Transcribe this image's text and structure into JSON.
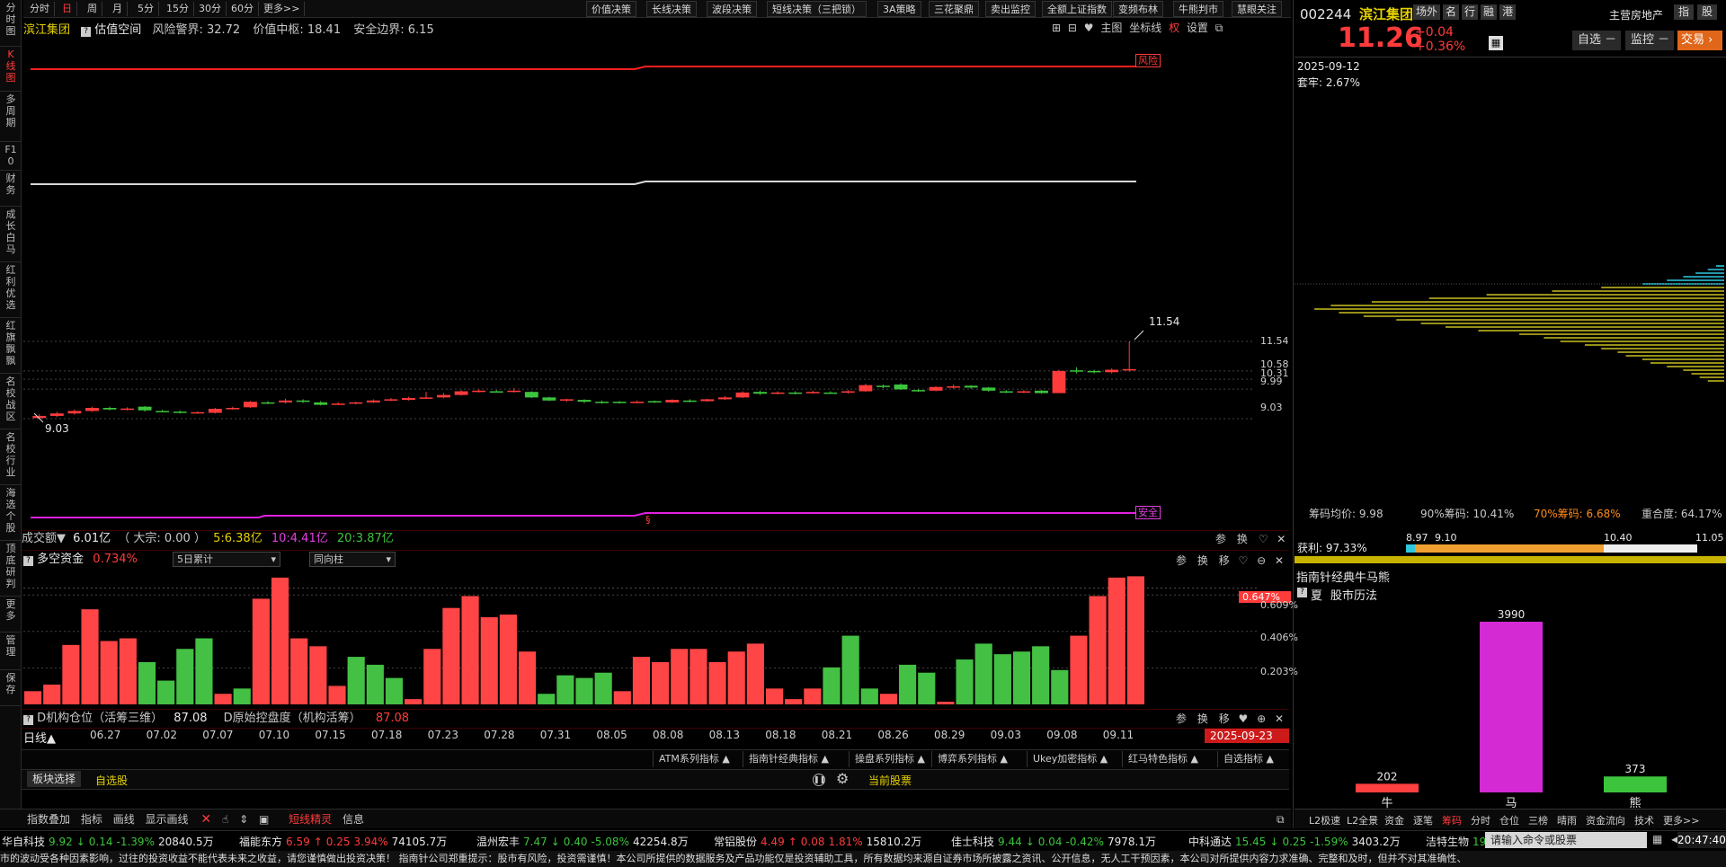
{
  "left_tabs": [
    {
      "label": "分时图",
      "active": false
    },
    {
      "label": "K线图",
      "active": true
    },
    {
      "label": "多周期",
      "active": false
    },
    {
      "label": "F10",
      "active": false
    },
    {
      "label": "财务",
      "active": false
    },
    {
      "label": "成长白马",
      "active": false
    },
    {
      "label": "红利优选",
      "active": false
    },
    {
      "label": "红旗飘飘",
      "active": false
    },
    {
      "label": "名校战区",
      "active": false
    },
    {
      "label": "名校行业",
      "active": false
    },
    {
      "label": "海选个股",
      "active": false
    },
    {
      "label": "顶底研判",
      "active": false
    },
    {
      "label": "更多",
      "active": false
    },
    {
      "label": "管理",
      "active": false
    },
    {
      "label": "保存",
      "active": false
    }
  ],
  "period_tabs": [
    "分时",
    "日",
    "周",
    "月",
    "5分",
    "15分",
    "30分",
    "60分",
    "更多>>"
  ],
  "active_period": "日",
  "strategy_tabs": [
    "价值决策",
    "长线决策",
    "波段决策",
    "短线决策（三把锁）",
    "3A策略",
    "三花聚鼎",
    "卖出监控",
    "全额上证指数",
    "变频布林",
    "牛熊判市",
    "慧眼关注"
  ],
  "chart_header": {
    "stock": "滨江集团",
    "indicator": "估值空间",
    "risk_label": "风险警界:",
    "risk_value": "32.72",
    "center_label": "价值中枢:",
    "center_value": "18.41",
    "safe_label": "安全边界:",
    "safe_value": "6.15",
    "tools": [
      "主图",
      "坐标线",
      "权",
      "设置"
    ]
  },
  "chart_labels": {
    "risk_tag": "风险",
    "safe_tag": "安全",
    "section_mark": "§"
  },
  "price_axis": [
    "11.54",
    "10.58",
    "10.31",
    "9.99",
    "9.03"
  ],
  "high_annot": "11.54",
  "low_annot": "9.03",
  "volume_header": {
    "label": "成交额▼",
    "amount": "6.01亿",
    "big_label": "（ 大宗: 0.00 ）",
    "ma5": "5:6.38亿",
    "ma10": "10:4.41亿",
    "ma20": "20:3.87亿",
    "tools": [
      "参",
      "换"
    ]
  },
  "fund_header": {
    "label": "多空资金",
    "value": "0.734%",
    "select1": "5日累计",
    "select2": "同向柱",
    "tools": [
      "参",
      "换",
      "移"
    ]
  },
  "fund_axis": [
    "0.647%",
    "0.609%",
    "0.406%",
    "0.203%"
  ],
  "inst_header": {
    "label1": "D机构仓位（活筹三维）",
    "value1": "87.08",
    "label2": "D原始控盘度（机构活筹）",
    "value2": "87.08",
    "tools": [
      "参",
      "换",
      "移"
    ]
  },
  "date_axis_label": "日线▲",
  "dates": [
    "06.27",
    "07.02",
    "07.07",
    "07.10",
    "07.15",
    "07.18",
    "07.23",
    "07.28",
    "07.31",
    "08.05",
    "08.08",
    "08.13",
    "08.18",
    "08.21",
    "08.26",
    "08.29",
    "09.03",
    "09.08",
    "09.11"
  ],
  "current_date_tag": "2025-09-23",
  "indicator_buttons": [
    "ATM系列指标 ▲",
    "指南针经典指标 ▲",
    "操盘系列指标 ▲",
    "博弈系列指标 ▲",
    "Ukey加密指标 ▲",
    "红马特色指标 ▲",
    "自选指标 ▲"
  ],
  "bottom_bar": {
    "block_select": "板块选择",
    "watchlist": "自选股",
    "current_stock": "当前股票"
  },
  "tools_bar": [
    "指数叠加",
    "指标",
    "画线",
    "显示画线"
  ],
  "tools_bar2": [
    "短线精灵",
    "信息"
  ],
  "ticker": [
    {
      "name": "华自科技",
      "price": "9.92",
      "arrow": "↓",
      "change": "0.14",
      "pct": "-1.39%",
      "amount": "20840.5万",
      "up": false
    },
    {
      "name": "福能东方",
      "price": "6.59",
      "arrow": "↑",
      "change": "0.25",
      "pct": "3.94%",
      "amount": "74105.7万",
      "up": true
    },
    {
      "name": "温州宏丰",
      "price": "7.47",
      "arrow": "↓",
      "change": "0.40",
      "pct": "-5.08%",
      "amount": "42254.8万",
      "up": false
    },
    {
      "name": "常铝股份",
      "price": "4.49",
      "arrow": "↑",
      "change": "0.08",
      "pct": "1.81%",
      "amount": "15810.2万",
      "up": true
    },
    {
      "name": "佳士科技",
      "price": "9.44",
      "arrow": "↓",
      "change": "0.04",
      "pct": "-0.42%",
      "amount": "7978.1万",
      "up": false
    },
    {
      "name": "中科通达",
      "price": "15.45",
      "arrow": "↓",
      "change": "0.25",
      "pct": "-1.59%",
      "amount": "3403.2万",
      "up": false
    },
    {
      "name": "洁特生物",
      "price": "19",
      "arrow": "",
      "change": "",
      "pct": "",
      "amount": "",
      "up": false
    }
  ],
  "command_placeholder": "请输入命令或股票",
  "clock": "20:47:40",
  "disclaimer": "市的波动受各种因素影响，过往的投资收益不能代表未来之收益，请您谨慎做出投资决策！        指南针公司郑重提示：股市有风险，投资需谨慎！本公司所提供的数据服务及产品功能仅是投资辅助工具，所有数据均来源自证券市场所披露之资讯、公开信息，无人工干预因素，本公司对所提供内容力求准确、完整和及时，但并不对其准确性、",
  "right": {
    "code": "002244",
    "name": "滨江集团",
    "tags": [
      "场外",
      "名",
      "行",
      "融",
      "港"
    ],
    "industry": "主营房地产",
    "top_btns": [
      "指",
      "股"
    ],
    "price": "11.26",
    "change": "+0.04",
    "pct": "+0.36%",
    "btn_watch": "自选",
    "btn_monitor": "监控",
    "btn_trade": "交易",
    "date": "2025-09-12",
    "trapped": "套牢: 2.67%",
    "chip_avg": "筹码均价: 9.98",
    "chip90": "90%筹码: 10.41%",
    "chip70": "70%筹码: 6.68%",
    "overlap": "重合度: 64.17%",
    "profit": "获利: 97.33%",
    "scale": [
      "8.97",
      "9.10",
      "10.40",
      "11.05"
    ],
    "bull_title": "指南针经典牛马熊",
    "market_hist_tag": "夏",
    "market_hist": "股市历法",
    "bmb": [
      {
        "label": "牛",
        "value": 202,
        "color": "#ff4040"
      },
      {
        "label": "马",
        "value": 3990,
        "color": "#d42ad4"
      },
      {
        "label": "熊",
        "value": 373,
        "color": "#3cc43c"
      }
    ],
    "bottom_tabs": [
      "L2极速",
      "L2全景",
      "资金",
      "逐笔",
      "筹码",
      "分时",
      "仓位",
      "三榜",
      "晴雨",
      "资金流向",
      "技术",
      "更多>>"
    ],
    "active_bottom_tab": "筹码"
  },
  "candles": [
    {
      "o": 9.05,
      "c": 9.12,
      "h": 9.18,
      "l": 9.03
    },
    {
      "o": 9.12,
      "c": 9.2,
      "h": 9.25,
      "l": 9.08
    },
    {
      "o": 9.2,
      "c": 9.28,
      "h": 9.33,
      "l": 9.16
    },
    {
      "o": 9.28,
      "c": 9.38,
      "h": 9.42,
      "l": 9.25
    },
    {
      "o": 9.38,
      "c": 9.33,
      "h": 9.42,
      "l": 9.3
    },
    {
      "o": 9.33,
      "c": 9.36,
      "h": 9.4,
      "l": 9.3
    },
    {
      "o": 9.42,
      "c": 9.3,
      "h": 9.44,
      "l": 9.26
    },
    {
      "o": 9.28,
      "c": 9.26,
      "h": 9.32,
      "l": 9.24
    },
    {
      "o": 9.26,
      "c": 9.24,
      "h": 9.3,
      "l": 9.2
    },
    {
      "o": 9.22,
      "c": 9.24,
      "h": 9.27,
      "l": 9.2
    },
    {
      "o": 9.22,
      "c": 9.35,
      "h": 9.38,
      "l": 9.2
    },
    {
      "o": 9.35,
      "c": 9.38,
      "h": 9.42,
      "l": 9.32
    },
    {
      "o": 9.4,
      "c": 9.58,
      "h": 9.6,
      "l": 9.38
    },
    {
      "o": 9.56,
      "c": 9.54,
      "h": 9.6,
      "l": 9.5
    },
    {
      "o": 9.56,
      "c": 9.62,
      "h": 9.68,
      "l": 9.52
    },
    {
      "o": 9.62,
      "c": 9.58,
      "h": 9.66,
      "l": 9.54
    },
    {
      "o": 9.56,
      "c": 9.48,
      "h": 9.6,
      "l": 9.46
    },
    {
      "o": 9.5,
      "c": 9.52,
      "h": 9.56,
      "l": 9.48
    },
    {
      "o": 9.54,
      "c": 9.56,
      "h": 9.58,
      "l": 9.5
    },
    {
      "o": 9.56,
      "c": 9.62,
      "h": 9.66,
      "l": 9.54
    },
    {
      "o": 9.62,
      "c": 9.66,
      "h": 9.7,
      "l": 9.6
    },
    {
      "o": 9.64,
      "c": 9.7,
      "h": 9.74,
      "l": 9.62
    },
    {
      "o": 9.7,
      "c": 9.72,
      "h": 9.9,
      "l": 9.68
    },
    {
      "o": 9.72,
      "c": 9.8,
      "h": 9.86,
      "l": 9.7
    },
    {
      "o": 9.8,
      "c": 9.92,
      "h": 9.96,
      "l": 9.78
    },
    {
      "o": 9.92,
      "c": 9.94,
      "h": 9.98,
      "l": 9.88
    },
    {
      "o": 9.92,
      "c": 9.9,
      "h": 9.96,
      "l": 9.88
    },
    {
      "o": 9.9,
      "c": 9.94,
      "h": 10.02,
      "l": 9.88
    },
    {
      "o": 9.9,
      "c": 9.72,
      "h": 9.92,
      "l": 9.7
    },
    {
      "o": 9.72,
      "c": 9.62,
      "h": 9.74,
      "l": 9.6
    },
    {
      "o": 9.62,
      "c": 9.66,
      "h": 9.68,
      "l": 9.58
    },
    {
      "o": 9.64,
      "c": 9.58,
      "h": 9.66,
      "l": 9.54
    },
    {
      "o": 9.58,
      "c": 9.56,
      "h": 9.62,
      "l": 9.52
    },
    {
      "o": 9.58,
      "c": 9.54,
      "h": 9.6,
      "l": 9.52
    },
    {
      "o": 9.56,
      "c": 9.58,
      "h": 9.62,
      "l": 9.54
    },
    {
      "o": 9.6,
      "c": 9.56,
      "h": 9.62,
      "l": 9.54
    },
    {
      "o": 9.56,
      "c": 9.64,
      "h": 9.66,
      "l": 9.54
    },
    {
      "o": 9.62,
      "c": 9.58,
      "h": 9.66,
      "l": 9.56
    },
    {
      "o": 9.6,
      "c": 9.66,
      "h": 9.68,
      "l": 9.58
    },
    {
      "o": 9.66,
      "c": 9.72,
      "h": 9.76,
      "l": 9.64
    },
    {
      "o": 9.72,
      "c": 9.88,
      "h": 9.92,
      "l": 9.7
    },
    {
      "o": 9.9,
      "c": 9.84,
      "h": 9.94,
      "l": 9.8
    },
    {
      "o": 9.86,
      "c": 9.88,
      "h": 9.92,
      "l": 9.82
    },
    {
      "o": 9.88,
      "c": 9.86,
      "h": 9.92,
      "l": 9.82
    },
    {
      "o": 9.86,
      "c": 9.9,
      "h": 9.94,
      "l": 9.84
    },
    {
      "o": 9.88,
      "c": 9.86,
      "h": 9.92,
      "l": 9.84
    },
    {
      "o": 9.88,
      "c": 9.92,
      "h": 9.96,
      "l": 9.84
    },
    {
      "o": 9.92,
      "c": 10.12,
      "h": 10.16,
      "l": 9.9
    },
    {
      "o": 10.1,
      "c": 10.06,
      "h": 10.14,
      "l": 10.02
    },
    {
      "o": 10.14,
      "c": 9.98,
      "h": 10.18,
      "l": 9.96
    },
    {
      "o": 9.96,
      "c": 9.92,
      "h": 10.0,
      "l": 9.9
    },
    {
      "o": 9.94,
      "c": 10.06,
      "h": 10.08,
      "l": 9.92
    },
    {
      "o": 10.04,
      "c": 10.08,
      "h": 10.14,
      "l": 10.0
    },
    {
      "o": 10.1,
      "c": 10.04,
      "h": 10.12,
      "l": 10.0
    },
    {
      "o": 10.04,
      "c": 9.94,
      "h": 10.06,
      "l": 9.9
    },
    {
      "o": 9.92,
      "c": 9.88,
      "h": 9.96,
      "l": 9.86
    },
    {
      "o": 9.9,
      "c": 9.92,
      "h": 9.96,
      "l": 9.86
    },
    {
      "o": 9.94,
      "c": 9.86,
      "h": 9.96,
      "l": 9.84
    },
    {
      "o": 9.86,
      "c": 10.58,
      "h": 10.62,
      "l": 9.86
    },
    {
      "o": 10.6,
      "c": 10.56,
      "h": 10.7,
      "l": 10.5
    },
    {
      "o": 10.58,
      "c": 10.54,
      "h": 10.62,
      "l": 10.5
    },
    {
      "o": 10.54,
      "c": 10.62,
      "h": 10.66,
      "l": 10.5
    },
    {
      "o": 10.6,
      "c": 10.64,
      "h": 11.54,
      "l": 10.56
    }
  ],
  "line_levels": {
    "risk": 32.72,
    "center": 18.41,
    "safe": 6.15
  },
  "volume_bars": [
    {
      "v": 0.1,
      "up": true
    },
    {
      "v": 0.15,
      "up": true
    },
    {
      "v": 0.45,
      "up": true
    },
    {
      "v": 0.72,
      "up": true
    },
    {
      "v": 0.48,
      "up": true
    },
    {
      "v": 0.5,
      "up": true
    },
    {
      "v": 0.32,
      "up": false
    },
    {
      "v": 0.18,
      "up": false
    },
    {
      "v": 0.42,
      "up": false
    },
    {
      "v": 0.5,
      "up": false
    },
    {
      "v": 0.08,
      "up": true
    },
    {
      "v": 0.12,
      "up": false
    },
    {
      "v": 0.8,
      "up": true
    },
    {
      "v": 0.96,
      "up": true
    },
    {
      "v": 0.5,
      "up": true
    },
    {
      "v": 0.44,
      "up": true
    },
    {
      "v": 0.14,
      "up": true
    },
    {
      "v": 0.36,
      "up": false
    },
    {
      "v": 0.3,
      "up": false
    },
    {
      "v": 0.2,
      "up": false
    },
    {
      "v": 0.04,
      "up": true
    },
    {
      "v": 0.42,
      "up": true
    },
    {
      "v": 0.73,
      "up": true
    },
    {
      "v": 0.82,
      "up": true
    },
    {
      "v": 0.66,
      "up": true
    },
    {
      "v": 0.68,
      "up": true
    },
    {
      "v": 0.4,
      "up": true
    },
    {
      "v": 0.08,
      "up": false
    },
    {
      "v": 0.22,
      "up": false
    },
    {
      "v": 0.2,
      "up": false
    },
    {
      "v": 0.24,
      "up": false
    },
    {
      "v": 0.1,
      "up": true
    },
    {
      "v": 0.36,
      "up": true
    },
    {
      "v": 0.32,
      "up": true
    },
    {
      "v": 0.42,
      "up": true
    },
    {
      "v": 0.42,
      "up": true
    },
    {
      "v": 0.32,
      "up": true
    },
    {
      "v": 0.4,
      "up": true
    },
    {
      "v": 0.46,
      "up": true
    },
    {
      "v": 0.12,
      "up": true
    },
    {
      "v": 0.04,
      "up": true
    },
    {
      "v": 0.12,
      "up": true
    },
    {
      "v": 0.28,
      "up": false
    },
    {
      "v": 0.52,
      "up": false
    },
    {
      "v": 0.12,
      "up": false
    },
    {
      "v": 0.08,
      "up": true
    },
    {
      "v": 0.3,
      "up": false
    },
    {
      "v": 0.24,
      "up": false
    },
    {
      "v": 0.02,
      "up": true
    },
    {
      "v": 0.34,
      "up": false
    },
    {
      "v": 0.46,
      "up": false
    },
    {
      "v": 0.38,
      "up": false
    },
    {
      "v": 0.4,
      "up": false
    },
    {
      "v": 0.44,
      "up": false
    },
    {
      "v": 0.26,
      "up": false
    },
    {
      "v": 0.52,
      "up": true
    },
    {
      "v": 0.82,
      "up": true
    },
    {
      "v": 0.96,
      "up": true
    },
    {
      "v": 0.97,
      "up": true
    }
  ],
  "chip_bars": [
    {
      "y": 0.0,
      "len": 0.02,
      "c": "#2ec8e0"
    },
    {
      "y": 0.02,
      "len": 0.04,
      "c": "#2ec8e0"
    },
    {
      "y": 0.04,
      "len": 0.07,
      "c": "#2ec8e0"
    },
    {
      "y": 0.06,
      "len": 0.1,
      "c": "#2ec8e0"
    },
    {
      "y": 0.08,
      "len": 0.14,
      "c": "#2ec8e0"
    },
    {
      "y": 0.1,
      "len": 0.2,
      "c": "#2ec8e0"
    },
    {
      "y": 0.12,
      "len": 0.3,
      "c": "#c8c020"
    },
    {
      "y": 0.14,
      "len": 0.42,
      "c": "#c8c020"
    },
    {
      "y": 0.16,
      "len": 0.58,
      "c": "#c8c020"
    },
    {
      "y": 0.18,
      "len": 0.72,
      "c": "#c8c020"
    },
    {
      "y": 0.2,
      "len": 0.86,
      "c": "#c8c020"
    },
    {
      "y": 0.22,
      "len": 0.96,
      "c": "#c8c020"
    },
    {
      "y": 0.24,
      "len": 1.0,
      "c": "#c8c020"
    },
    {
      "y": 0.26,
      "len": 0.94,
      "c": "#c8c020"
    },
    {
      "y": 0.28,
      "len": 0.88,
      "c": "#c8c020"
    },
    {
      "y": 0.3,
      "len": 0.8,
      "c": "#c8c020"
    },
    {
      "y": 0.32,
      "len": 0.74,
      "c": "#c8c020"
    },
    {
      "y": 0.34,
      "len": 0.68,
      "c": "#c8c020"
    },
    {
      "y": 0.36,
      "len": 0.6,
      "c": "#c8c020"
    },
    {
      "y": 0.38,
      "len": 0.5,
      "c": "#c8c020"
    },
    {
      "y": 0.4,
      "len": 0.44,
      "c": "#c8c020"
    },
    {
      "y": 0.42,
      "len": 0.4,
      "c": "#c8c020"
    },
    {
      "y": 0.44,
      "len": 0.34,
      "c": "#c8c020"
    },
    {
      "y": 0.46,
      "len": 0.3,
      "c": "#c8c020"
    },
    {
      "y": 0.48,
      "len": 0.26,
      "c": "#c8c020"
    },
    {
      "y": 0.5,
      "len": 0.24,
      "c": "#c8c020"
    },
    {
      "y": 0.52,
      "len": 0.2,
      "c": "#c8c020"
    },
    {
      "y": 0.54,
      "len": 0.18,
      "c": "#c8c020"
    },
    {
      "y": 0.56,
      "len": 0.14,
      "c": "#c8c020"
    },
    {
      "y": 0.58,
      "len": 0.1,
      "c": "#c8c020"
    },
    {
      "y": 0.6,
      "len": 0.08,
      "c": "#c8c020"
    },
    {
      "y": 0.62,
      "len": 0.06,
      "c": "#c8c020"
    },
    {
      "y": 0.64,
      "len": 0.04,
      "c": "#c8c020"
    }
  ]
}
